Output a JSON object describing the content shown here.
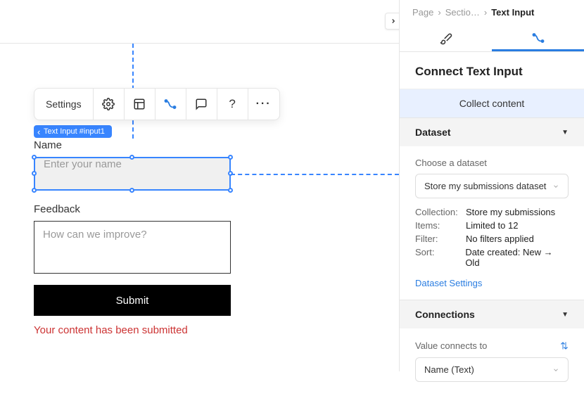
{
  "toolbar": {
    "settings_label": "Settings"
  },
  "element_tag": "Text Input #input1",
  "form": {
    "name_label": "Name",
    "name_placeholder": "Enter your name",
    "feedback_label": "Feedback",
    "feedback_placeholder": "How can we improve?",
    "submit_label": "Submit",
    "success_msg": "Your content has been submitted"
  },
  "breadcrumb": {
    "a": "Page",
    "b": "Sectio…",
    "c": "Text Input"
  },
  "panel": {
    "title": "Connect Text Input",
    "collect_label": "Collect content",
    "dataset_section": "Dataset",
    "choose_label": "Choose a dataset",
    "dataset_selected": "Store my submissions dataset",
    "collection_k": "Collection:",
    "collection_v": "Store my submissions",
    "items_k": "Items:",
    "items_v": "Limited to 12",
    "filter_k": "Filter:",
    "filter_v": "No filters applied",
    "sort_k": "Sort:",
    "sort_v": "Date created: New → Old",
    "dataset_settings": "Dataset Settings",
    "connections_section": "Connections",
    "value_connects": "Value connects to",
    "value_selected": "Name (Text)"
  }
}
